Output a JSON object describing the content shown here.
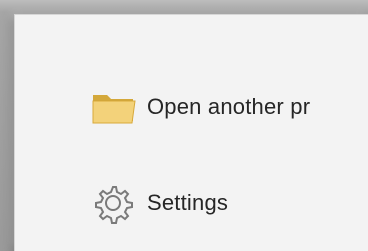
{
  "menu": {
    "items": [
      {
        "label": "Open another pr",
        "icon": "folder-icon",
        "icon_color": "#e9c15a"
      },
      {
        "label": "Settings",
        "icon": "gear-icon",
        "icon_color": "#7a7a7a"
      }
    ]
  }
}
